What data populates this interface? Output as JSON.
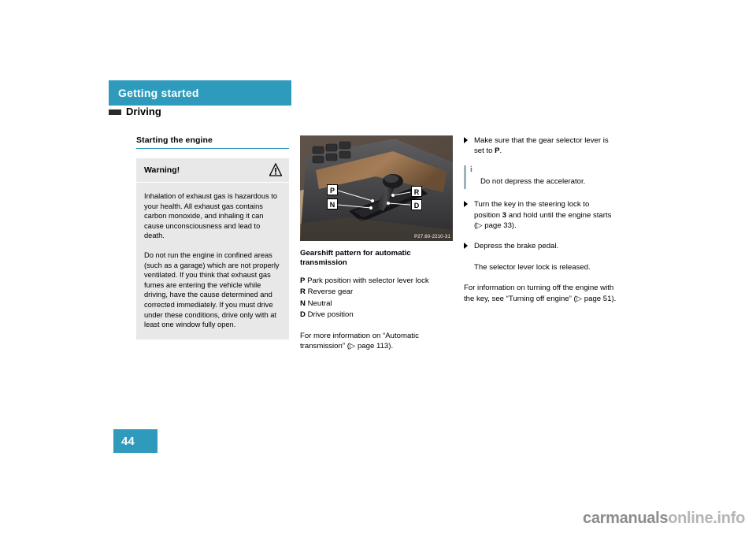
{
  "header": {
    "chapter": "Getting started",
    "section": "Driving"
  },
  "page_number": "44",
  "col1": {
    "section_title": "Starting the engine",
    "warning": {
      "label": "Warning!",
      "icon": "warning-triangle-icon",
      "paragraphs": [
        "Inhalation of exhaust gas is hazardous to your health. All exhaust gas contains carbon monoxide, and inhaling it can cause unconsciousness and lead to death.",
        "Do not run the engine in confined areas (such as a garage) which are not properly ventilated. If you think that exhaust gas fumes are entering the vehicle while driving, have the cause determined and corrected immediately. If you must drive under these conditions, drive only with at least one window fully open."
      ]
    }
  },
  "col2": {
    "figure": {
      "code": "P27.60-2210-31",
      "labels": [
        "P",
        "N",
        "R",
        "D"
      ]
    },
    "figure_title": "Gearshift pattern for automatic transmission",
    "definitions": [
      {
        "key": "P",
        "text": "Park position with selector lever lock"
      },
      {
        "key": "R",
        "text": "Reverse gear"
      },
      {
        "key": "N",
        "text": "Neutral"
      },
      {
        "key": "D",
        "text": "Drive position"
      }
    ],
    "more_info": "For more information on “Automatic transmission” (▷ page 113)."
  },
  "col3": {
    "items": [
      {
        "type": "bullet",
        "text_html": "Make sure that the gear selector lever is set to <b>P</b>."
      },
      {
        "type": "note",
        "text": "Do not depress the accelerator."
      },
      {
        "type": "bullet",
        "text_html": "Turn the key in the steering lock to position <b>3</b> and hold until the engine starts (▷ page 33)."
      },
      {
        "type": "bullet",
        "text_html": "Depress the brake pedal."
      },
      {
        "type": "indent",
        "text_html": "The selector lever lock is released."
      },
      {
        "type": "plain",
        "text_html": "For information on turning off the engine with the key, see “Turning off engine” (▷ page 51)."
      }
    ]
  },
  "watermark": {
    "part1": "carmanuals",
    "part2": "online.info"
  },
  "colors": {
    "accent": "#2e9bbd",
    "warn_box": "#e8e8e8",
    "note_bar": "#9fb3bd"
  }
}
